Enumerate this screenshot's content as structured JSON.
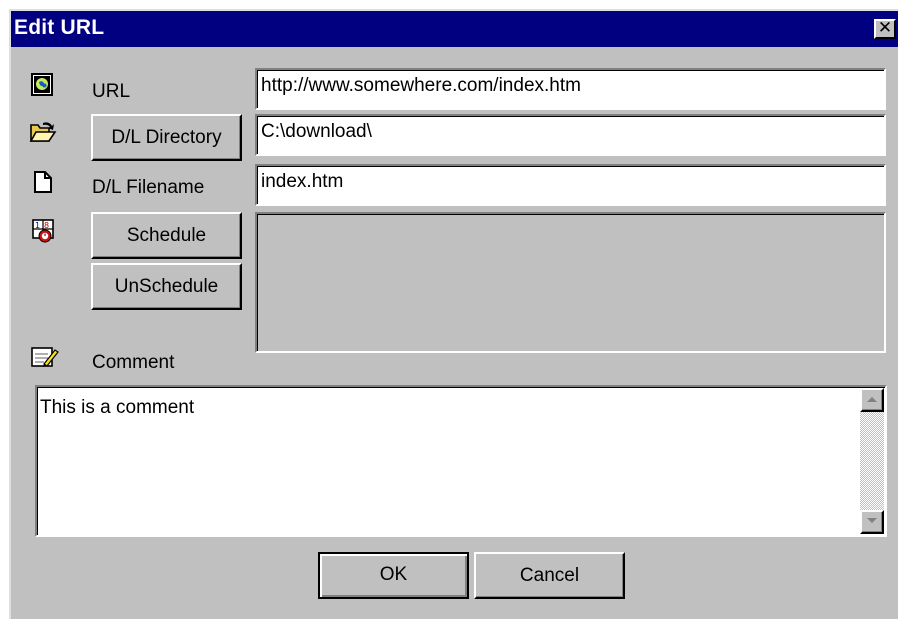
{
  "window": {
    "title": "Edit URL",
    "close_glyph": "✕"
  },
  "form": {
    "url_label": "URL",
    "url_value": "http://www.somewhere.com/index.htm",
    "directory_button": "D/L Directory",
    "directory_value": "C:\\download\\",
    "filename_label": "D/L Filename",
    "filename_value": "index.htm",
    "schedule_button": "Schedule",
    "unschedule_button": "UnSchedule",
    "comment_label": "Comment",
    "comment_value": "This is a comment"
  },
  "footer": {
    "ok_label": "OK",
    "cancel_label": "Cancel"
  },
  "icons": {
    "url": "globe-icon",
    "directory": "open-folder-icon",
    "filename": "document-icon",
    "schedule": "calendar-clock-icon",
    "comment": "notepad-pencil-icon",
    "scroll_up": "scroll-up-arrow-icon",
    "scroll_down": "scroll-down-arrow-icon"
  },
  "colors": {
    "titlebar": "#000080",
    "face": "#c0c0c0",
    "field": "#ffffff"
  }
}
